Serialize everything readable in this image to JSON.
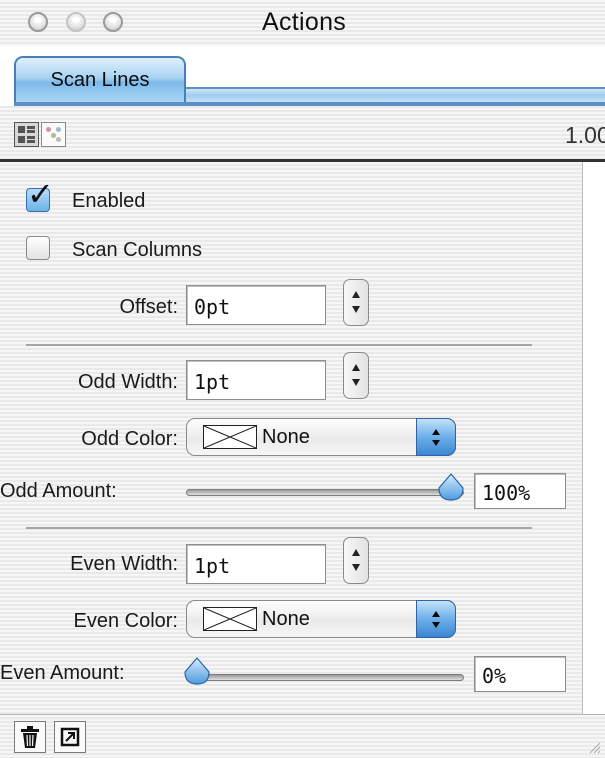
{
  "window": {
    "title": "Actions"
  },
  "tabs": [
    {
      "label": "Scan Lines",
      "selected": true
    }
  ],
  "toolbar": {
    "zoom_readout": "1.00"
  },
  "controls": {
    "enabled": {
      "label": "Enabled",
      "checked": true
    },
    "scan_columns": {
      "label": "Scan Columns",
      "checked": false
    },
    "offset": {
      "label": "Offset:",
      "value": "0pt"
    },
    "odd_width": {
      "label": "Odd Width:",
      "value": "1pt"
    },
    "odd_color": {
      "label": "Odd Color:",
      "value": "None"
    },
    "odd_amount": {
      "label": "Odd Amount:",
      "value": "100%",
      "level": 1.0
    },
    "even_width": {
      "label": "Even Width:",
      "value": "1pt"
    },
    "even_color": {
      "label": "Even Color:",
      "value": "None"
    },
    "even_amount": {
      "label": "Even Amount:",
      "value": "0%",
      "level": 0.0
    }
  },
  "icons": {
    "close": "close-light-icon",
    "minimize": "minimize-light-icon",
    "zoom": "zoom-light-icon",
    "list_view": "list-view-icon",
    "properties_view": "properties-view-icon",
    "trash": "trash-icon",
    "new_action": "new-action-icon",
    "resize": "resize-grip-icon"
  },
  "colors": {
    "tab_accent": "#7db9e8",
    "popup_accent": "#3d86d4",
    "checkbox_checked": "#6cb3ea"
  }
}
